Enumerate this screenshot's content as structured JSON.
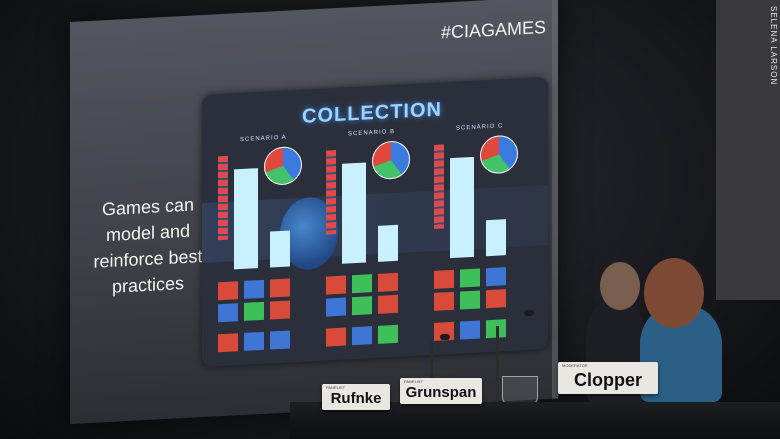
{
  "slide": {
    "hashtag": "#CIAGAMES",
    "text": [
      "Games can",
      "model and",
      "reinforce best",
      "practices"
    ],
    "mock_title": "COLLECTION",
    "scenarios": [
      "SCENARIO A",
      "SCENARIO B",
      "SCENARIO C"
    ]
  },
  "nameplates": [
    {
      "small": "PANELIST",
      "name": "Rufnke"
    },
    {
      "small": "PANELIST",
      "name": "Grunspan"
    },
    {
      "small": "MODERATOR",
      "name": "Clopper"
    }
  ],
  "credit": "SELENA LARSON",
  "colors": {
    "screen": "#4a4d55",
    "slide_text": "#f4f4f4",
    "mock_bg": "#2b2f3c",
    "title_glow": "#9fd3ff",
    "red": "#d84a3a",
    "blue": "#3f76d6",
    "green": "#3fbf5a",
    "light_bar": "#c8f0ff"
  }
}
